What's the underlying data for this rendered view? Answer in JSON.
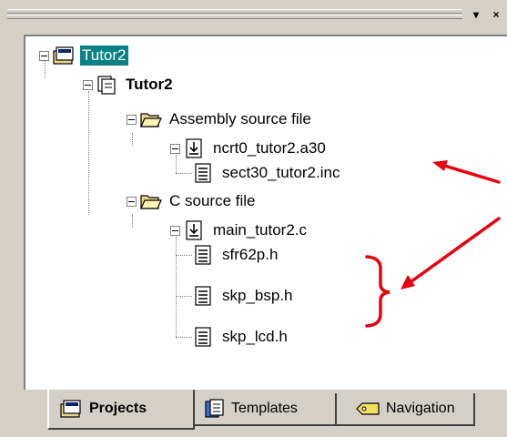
{
  "window": {
    "minimize_glyph": "▾",
    "close_glyph": "×"
  },
  "tree": {
    "workspace": "Tutor2",
    "project": "Tutor2",
    "group_asm": "Assembly source file",
    "file_asm": "ncrt0_tutor2.a30",
    "file_inc": "sect30_tutor2.inc",
    "group_c": "C source file",
    "file_c": "main_tutor2.c",
    "header_1": "sfr62p.h",
    "header_2": "skp_bsp.h",
    "header_3": "skp_lcd.h"
  },
  "tabs": {
    "projects": "Projects",
    "templates": "Templates",
    "navigation": "Navigation"
  },
  "colors": {
    "selection": "#0a8284",
    "annotation": "#e8000c"
  }
}
